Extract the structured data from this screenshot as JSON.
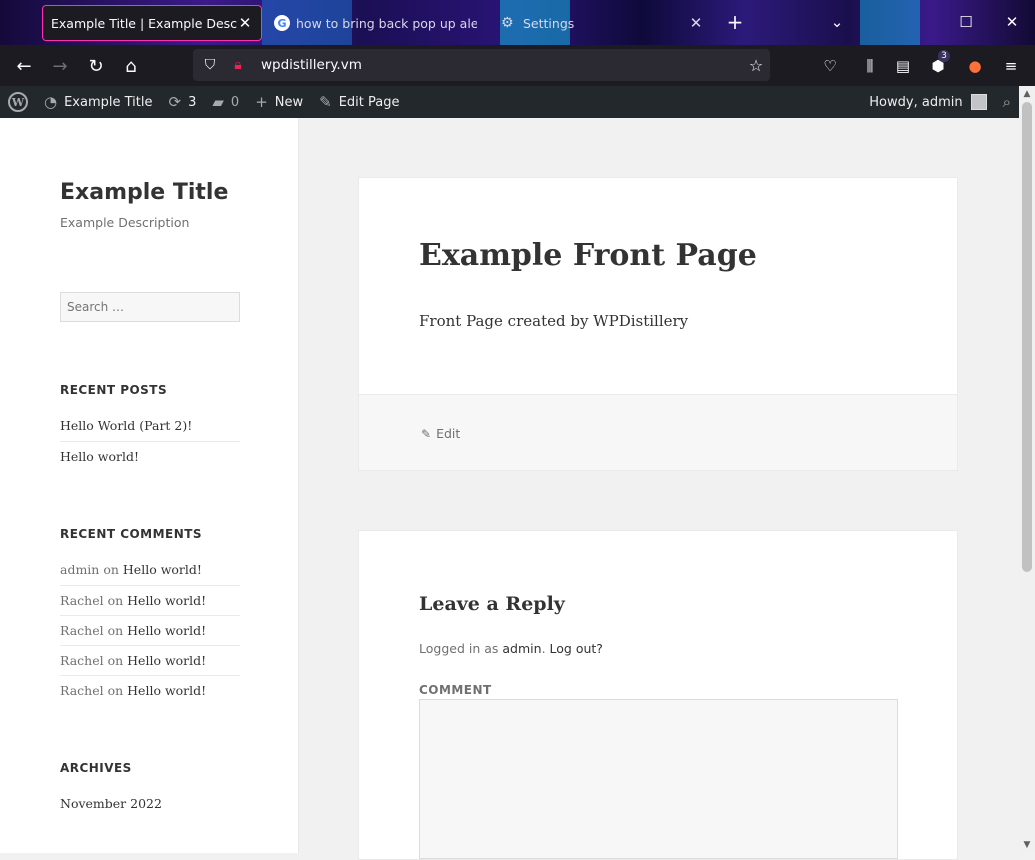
{
  "browser": {
    "tabs": [
      {
        "title": "Example Title | Example Description",
        "active": true
      },
      {
        "title": "how to bring back pop up alert",
        "icon": "google-icon"
      },
      {
        "title": "Settings",
        "icon": "gear-icon"
      }
    ],
    "new_tab": "+",
    "address": "wpdistillery.vm",
    "extension_badge": "3"
  },
  "adminbar": {
    "site_name": "Example Title",
    "updates_count": "3",
    "comments_count": "0",
    "new_label": "New",
    "edit_label": "Edit Page",
    "howdy": "Howdy, admin"
  },
  "sidebar": {
    "site_title": "Example Title",
    "site_description": "Example Description",
    "search_placeholder": "Search …",
    "recent_posts_title": "RECENT POSTS",
    "recent_posts": [
      "Hello World (Part 2)!",
      "Hello world!"
    ],
    "recent_comments_title": "RECENT COMMENTS",
    "recent_comments": [
      {
        "author": "admin",
        "on": "on",
        "post": "Hello world!"
      },
      {
        "author": "Rachel",
        "on": "on",
        "post": "Hello world!"
      },
      {
        "author": "Rachel",
        "on": "on",
        "post": "Hello world!"
      },
      {
        "author": "Rachel",
        "on": "on",
        "post": "Hello world!"
      },
      {
        "author": "Rachel",
        "on": "on",
        "post": "Hello world!"
      }
    ],
    "archives_title": "ARCHIVES",
    "archives": [
      "November 2022"
    ]
  },
  "main": {
    "page_title": "Example Front Page",
    "page_body": "Front Page created by WPDistillery",
    "edit_link": "Edit",
    "reply_title": "Leave a Reply",
    "logged_in_prefix": "Logged in as",
    "logged_in_user": "admin",
    "logout": "Log out?",
    "comment_label": "COMMENT"
  }
}
